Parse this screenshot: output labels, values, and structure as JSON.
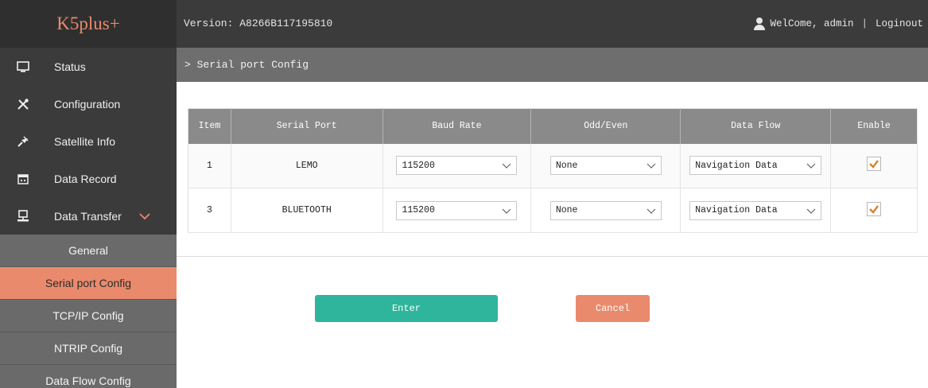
{
  "app": {
    "logo": "K5plus+",
    "version": "Version: A8266B117195810",
    "welcome": "WelCome, admin",
    "separator": "|",
    "logout": "Loginout"
  },
  "sidebar": {
    "items": [
      {
        "label": "Status",
        "icon": "monitor-icon"
      },
      {
        "label": "Configuration",
        "icon": "tools-icon"
      },
      {
        "label": "Satellite Info",
        "icon": "satellite-icon"
      },
      {
        "label": "Data Record",
        "icon": "calendar-icon"
      },
      {
        "label": "Data Transfer",
        "icon": "network-icon"
      }
    ],
    "subitems": [
      {
        "label": "General",
        "active": false
      },
      {
        "label": "Serial port Config",
        "active": true
      },
      {
        "label": "TCP/IP Config",
        "active": false
      },
      {
        "label": "NTRIP Config",
        "active": false
      },
      {
        "label": "Data Flow Config",
        "active": false
      }
    ]
  },
  "breadcrumb": "> Serial port Config",
  "table": {
    "headers": [
      "Item",
      "Serial Port",
      "Baud Rate",
      "Odd/Even",
      "Data Flow",
      "Enable"
    ],
    "rows": [
      {
        "item": "1",
        "port": "LEMO",
        "baud": "115200",
        "parity": "None",
        "flow": "Navigation Data",
        "enabled": true
      },
      {
        "item": "3",
        "port": "BLUETOOTH",
        "baud": "115200",
        "parity": "None",
        "flow": "Navigation Data",
        "enabled": true
      }
    ]
  },
  "buttons": {
    "enter": "Enter",
    "cancel": "Cancel"
  },
  "colors": {
    "accent": "#ea8a6d",
    "enter": "#2fb59b",
    "check": "#d9822b"
  }
}
